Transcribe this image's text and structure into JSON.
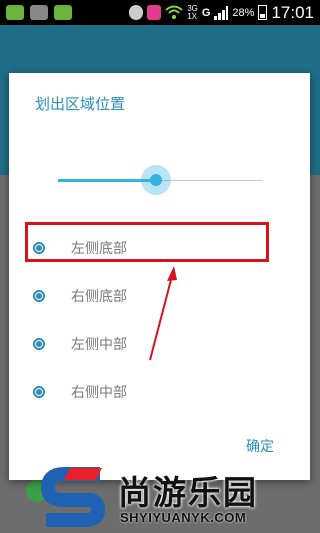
{
  "status_bar": {
    "signal_label": "3G\n1X",
    "network": "G",
    "battery": "28%",
    "time": "17:01"
  },
  "dialog": {
    "title": "划出区域位置",
    "slider_value_percent": 48,
    "options": [
      {
        "label": "左侧底部",
        "selected": true
      },
      {
        "label": "右侧底部",
        "selected": true
      },
      {
        "label": "左侧中部",
        "selected": true
      },
      {
        "label": "右侧中部",
        "selected": true
      }
    ],
    "ok_label": "确定"
  },
  "watermark": {
    "name": "尚游乐园",
    "url": "SHYIYUANYK.COM"
  },
  "colors": {
    "accent": "#2b8ebd",
    "slider": "#36b2e1",
    "highlight": "#d8141b",
    "watermark_red": "#e8202a",
    "watermark_blue": "#1e63b3"
  },
  "icons": [
    "wechat-icon",
    "gallery-icon",
    "wechat-icon",
    "alarm-icon",
    "app-icon",
    "wifi-icon",
    "signal-icon",
    "battery-icon"
  ]
}
